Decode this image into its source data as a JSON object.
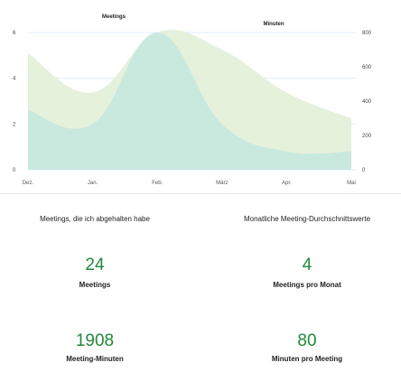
{
  "chart_data": {
    "type": "area",
    "title_left": "Meetings",
    "title_right": "Minuten",
    "categories": [
      "Dez.",
      "Jan.",
      "Feb.",
      "März",
      "Apr.",
      "Mai"
    ],
    "y_left": {
      "ticks": [
        "0",
        "2",
        "4",
        "6"
      ],
      "range": [
        0,
        6
      ]
    },
    "y_right": {
      "ticks": [
        "0",
        "200",
        "400",
        "600",
        "800"
      ],
      "range": [
        0,
        800
      ]
    },
    "series": [
      {
        "axis": "right",
        "color": "#e3f0d8",
        "values": [
          680,
          450,
          800,
          700,
          450,
          300
        ]
      },
      {
        "axis": "left",
        "color": "#bfe6df",
        "values": [
          2.6,
          2.0,
          6.0,
          2.0,
          0.8,
          0.8
        ]
      }
    ],
    "grid_color_left": "#d6e8ff"
  },
  "stats": [
    {
      "heading": "Meetings, die ich abgehalten habe",
      "value": "24",
      "label": "Meetings"
    },
    {
      "heading": "Monatliche Meeting-Durchschnittswerte",
      "value": "4",
      "label": "Meetings pro Monat"
    },
    {
      "heading": "",
      "value": "1908",
      "label": "Meeting-Minuten"
    },
    {
      "heading": "",
      "value": "80",
      "label": "Minuten pro Meeting"
    }
  ]
}
